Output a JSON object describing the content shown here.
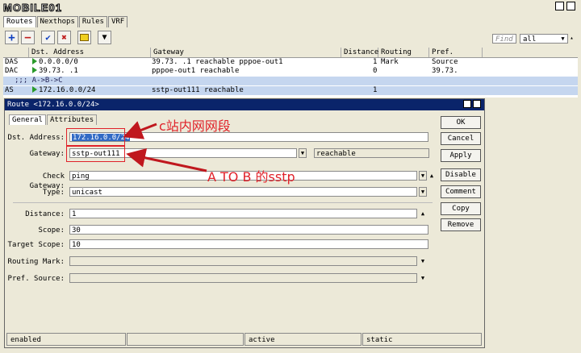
{
  "watermark": "MOBILE01",
  "tabs": [
    "Routes",
    "Nexthops",
    "Rules",
    "VRF"
  ],
  "toolbar": {
    "find_placeholder": "Find",
    "filter_value": "all",
    "icons": [
      "add-icon",
      "remove-icon",
      "enable-icon",
      "disable-icon",
      "comment-icon",
      "filter-icon"
    ]
  },
  "table": {
    "columns": [
      "",
      "Dst. Address",
      "Gateway",
      "Distance",
      "Routing Mark",
      "Pref. Source"
    ],
    "rows": [
      {
        "flags": "DAS",
        "dst": "0.0.0.0/0",
        "gateway": "39.73.   .1 reachable pppoe-out1",
        "distance": "1",
        "mark": "",
        "pref": ""
      },
      {
        "flags": "DAC",
        "dst": "39.73.   .1",
        "gateway": "pppoe-out1 reachable",
        "distance": "0",
        "mark": "",
        "pref": "39.73."
      },
      {
        "comment": ";;; A->B->C"
      },
      {
        "flags": "AS",
        "dst": "172.16.0.0/24",
        "gateway": "sstp-out111 reachable",
        "distance": "1",
        "mark": "",
        "pref": "",
        "selected": true
      }
    ]
  },
  "dialog": {
    "title": "Route <172.16.0.0/24>",
    "tabs": [
      "General",
      "Attributes"
    ],
    "fields": {
      "dst_address": {
        "label": "Dst. Address:",
        "value": "172.16.0.0/24"
      },
      "gateway": {
        "label": "Gateway:",
        "value": "sstp-out111",
        "state": "reachable"
      },
      "check_gateway": {
        "label": "Check Gateway:",
        "value": "ping"
      },
      "type": {
        "label": "Type:",
        "value": "unicast"
      },
      "distance": {
        "label": "Distance:",
        "value": "1"
      },
      "scope": {
        "label": "Scope:",
        "value": "30"
      },
      "target_scope": {
        "label": "Target Scope:",
        "value": "10"
      },
      "routing_mark": {
        "label": "Routing Mark:",
        "value": ""
      },
      "pref_source": {
        "label": "Pref. Source:",
        "value": ""
      }
    },
    "buttons": [
      "OK",
      "Cancel",
      "Apply",
      "Disable",
      "Comment",
      "Copy",
      "Remove"
    ],
    "status": [
      "enabled",
      "",
      "active",
      "static"
    ]
  },
  "annotations": {
    "note1": "c站内网网段",
    "note2": "A TO B 的sstp",
    "color": "#e0222a"
  }
}
